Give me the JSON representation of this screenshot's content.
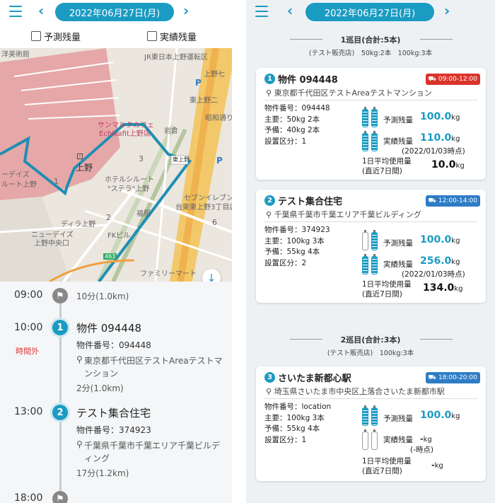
{
  "date": "2022年06月27日(月)",
  "left": {
    "checkbox_predict": "予測残量",
    "checkbox_actual": "実績残量",
    "map_labels": [
      "洋美術館",
      "JR東日本上野運転区",
      "上野七",
      "上野",
      "上野",
      "サンマルクカフェ",
      "Echikafit上野店",
      "東上野",
      "岩倉",
      "ホテルシルート",
      "\"ステラ\"上野",
      "福服",
      "セブンイレブン",
      "台東東上野3丁目店",
      "ディラ上野",
      "ニューデイズ",
      "上野中央口",
      "FKビル",
      "ファミリーマート",
      "ーデイズ",
      "ルート上野",
      "東上野二",
      "2",
      "1",
      "3",
      "6",
      "463",
      "昭和通り",
      "P",
      "P"
    ],
    "timeline": [
      {
        "time": "09:00",
        "marker": "flag",
        "detail": "10分(1.0km)"
      },
      {
        "time": "10:00",
        "marker": "1",
        "late": "時間外",
        "title": "物件 094448",
        "number": "物件番号：094448",
        "address1": "東京都千代田区テストAreaテストマ",
        "address2": "ンション",
        "travel": "2分(1.0km)"
      },
      {
        "time": "13:00",
        "marker": "2",
        "title": "テスト集合住宅",
        "number": "物件番号：374923",
        "address1": "千葉県千葉市千葉エリア千葉ビルデ",
        "address2": "ィング",
        "travel": "17分(1.2km)"
      },
      {
        "time": "18:00",
        "marker": "flag"
      }
    ]
  },
  "right": {
    "rounds": [
      {
        "title": "1巡目(合計:5本)",
        "sub": "(テスト販売店)　50kg:2本　100kg:3本"
      },
      {
        "title": "2巡目(合計:3本)",
        "sub": "(テスト販売店)　100kg:3本"
      }
    ],
    "cards": [
      {
        "num": "1",
        "name": "物件 094448",
        "badge": "09:00-12:00",
        "badge_color": "#d9342b",
        "address": "東京都千代田区テストAreaテストマンション",
        "info1": "物件番号：094448",
        "info2": "主要：50kg 2本",
        "info3": "予備：40kg 2本",
        "info4": "設置区分：1",
        "pred_label": "予測残量",
        "pred_value": "100.0",
        "act_label": "実績残量",
        "act_value": "110.0",
        "act_note": "(2022/01/03時点)",
        "avg_label1": "1日平均使用量",
        "avg_label2": "(直近7日間)",
        "avg_value": "10.0",
        "unit": "kg"
      },
      {
        "num": "2",
        "name": "テスト集合住宅",
        "badge": "12:00-14:00",
        "badge_color": "#2d7cc4",
        "address": "千葉県千葉市千葉エリア千葉ビルディング",
        "info1": "物件番号：374923",
        "info2": "主要：100kg 3本",
        "info3": "予備：55kg 4本",
        "info4": "設置区分：2",
        "pred_label": "予測残量",
        "pred_value": "100.0",
        "act_label": "実績残量",
        "act_value": "256.0",
        "act_note": "(2022/01/03時点)",
        "avg_label1": "1日平均使用量",
        "avg_label2": "(直近7日間)",
        "avg_value": "134.0",
        "unit": "kg"
      },
      {
        "num": "3",
        "name": "さいたま新都心駅",
        "badge": "18:00-20:00",
        "badge_color": "#2d7cc4",
        "address": "埼玉県さいたま市中央区上落合さいたま新都市駅",
        "info1": "物件番号：location",
        "info2": "主要：100kg 3本",
        "info3": "予備：55kg 4本",
        "info4": "設置区分：1",
        "pred_label": "予測残量",
        "pred_value": "100.0",
        "act_label": "実績残量",
        "act_value": "-",
        "act_note": "(-時点)",
        "avg_label1": "1日平均使用量",
        "avg_label2": "(直近7日間)",
        "avg_value": "-",
        "unit": "kg"
      }
    ]
  }
}
